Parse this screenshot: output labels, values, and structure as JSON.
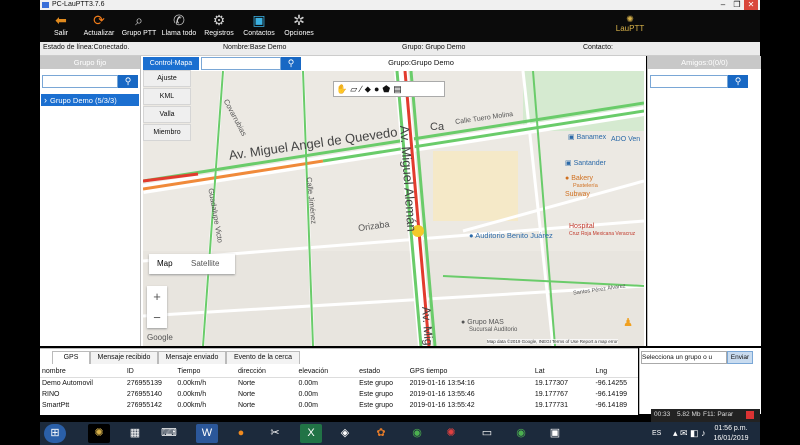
{
  "window": {
    "title": "PC-LauPTT3.7.6",
    "buttons": [
      "–",
      "❐",
      "✕"
    ]
  },
  "toolbar": {
    "items": [
      {
        "label": "Salir",
        "icon": "exit-icon",
        "glyph": "⬅",
        "color": "#e08a1e"
      },
      {
        "label": "Actualizar",
        "icon": "refresh-icon",
        "glyph": "⟳",
        "color": "#f07c1a"
      },
      {
        "label": "Grupo PTT",
        "icon": "radio-icon",
        "glyph": "⌕",
        "color": "#d0d0d0"
      },
      {
        "label": "Llama todo",
        "icon": "call-all-icon",
        "glyph": "✆",
        "color": "#d0d0d0"
      },
      {
        "label": "Registros",
        "icon": "records-icon",
        "glyph": "⚙",
        "color": "#d0d0d0"
      },
      {
        "label": "Contactos",
        "icon": "contacts-icon",
        "glyph": "▣",
        "color": "#3bb0e0"
      },
      {
        "label": "Opciones",
        "icon": "settings-icon",
        "glyph": "✲",
        "color": "#d0d0d0"
      }
    ],
    "logo": "LauPTT"
  },
  "status": {
    "line": "Estado de línea:Conectado.",
    "name": "Nombre:Base Demo",
    "group": "Grupo: Grupo Demo",
    "contact": "Contacto:"
  },
  "left_panel": {
    "header": "Grupo fijo",
    "search_value": "",
    "tree_item": "Grupo Demo (5/3/3)"
  },
  "center": {
    "tab": "Control-Mapa",
    "search_value": "",
    "title": "Grupo:Grupo Demo",
    "map_menu": [
      "Ajuste",
      "KML",
      "Valla",
      "Miembro"
    ],
    "map_type": [
      "Map",
      "Satellite"
    ],
    "zoom": [
      "+",
      "−"
    ],
    "google": "Google",
    "map_footer": "Map data ©2019 Google, INEGI    Terms of Use    Report a map error",
    "map_labels": {
      "street_quevedo": "Av. Miguel Angel de Quevedo",
      "street_aleman": "Av. Miguel Alemán",
      "street_aleman2": "Av. Mig",
      "orizaba": "Orizaba",
      "covarrubias": "Covarrubias",
      "guadalupe": "Guadalupe Victo",
      "jimenez": "Calle Jiménez",
      "tuero": "Calle Tuero Molina",
      "banamex": "Banamex",
      "santander": "Santander",
      "bakery": "Bakery",
      "subway": "Subway",
      "hospital": "Hospital",
      "auditorio": "Auditorio Benito Juárez",
      "grupo_mas": "Grupo MAS",
      "sucursal": "Sucursal Auditorio",
      "ado": "ADO Ven",
      "pasteleria": "Pastelería",
      "cruz_roja": "Cruz Roja Mexicana Veracruz",
      "canero": "Santos Pérez Álvarez",
      "ca": "Ca"
    }
  },
  "right_panel": {
    "header": "Amigos:0(0/0)",
    "search_value": ""
  },
  "bottom": {
    "tabs": [
      "GPS",
      "Mensaje recibido",
      "Mensaje enviado",
      "Evento de la cerca"
    ],
    "columns": [
      "nombre",
      "ID",
      "Tiempo",
      "dirección",
      "elevación",
      "estado",
      "GPS tiempo",
      "Lat",
      "Lng"
    ],
    "rows": [
      [
        "Demo Automovil",
        "276955139",
        "0.00km/h",
        "Norte",
        "0.00m",
        "Este grupo",
        "2019-01-16 13:54:16",
        "19.177307",
        "-96.14255"
      ],
      [
        "RINO",
        "276955140",
        "0.00km/h",
        "Norte",
        "0.00m",
        "Este grupo",
        "2019-01-16 13:55:46",
        "19.177767",
        "-96.14199"
      ],
      [
        "SmartPtt",
        "276955142",
        "0.00km/h",
        "Norte",
        "0.00m",
        "Este grupo",
        "2019-01-16 13:55:42",
        "19.177731",
        "-96.14189"
      ]
    ]
  },
  "send_panel": {
    "select_placeholder": "Selecciona un grupo o u",
    "send_label": "Enviar"
  },
  "media_bar": {
    "time": "00:33",
    "size": "5.82 Mb",
    "key": "F11: Parar"
  },
  "taskbar": {
    "lang": "ES",
    "time": "01:56 p.m.",
    "date": "16/01/2019"
  }
}
